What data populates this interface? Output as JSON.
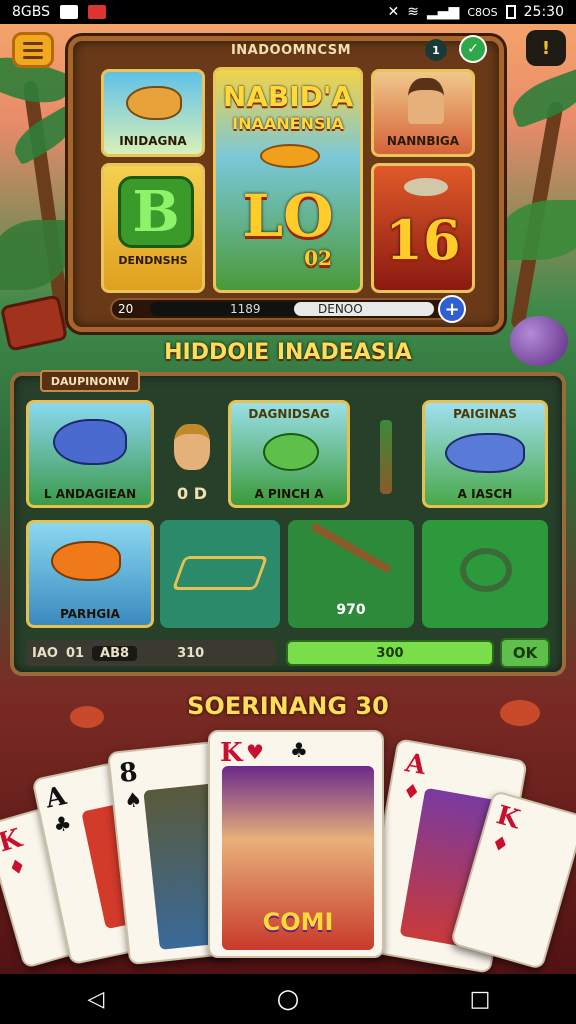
{
  "status_bar": {
    "left_text": "8GBS",
    "right_text": "C8OS",
    "time": "25:30"
  },
  "top_frame": {
    "title": "INADOOMNCSM",
    "tiles": [
      {
        "label": "INIDAGNA"
      },
      {
        "title_line1": "NABID'A",
        "title_line2": "INAANENSIA",
        "big_number": "LO",
        "small_number": "02"
      },
      {
        "label": "NANNBIGA"
      },
      {
        "label": "DENDNSHS"
      },
      {
        "big_number": "16"
      }
    ],
    "bar": {
      "left_value": "20",
      "mid_value": "1189",
      "right_value": "DENOO"
    },
    "plus_label": "+",
    "menu_badge": "!"
  },
  "mid_heading": "HIDDOIE INADEASIA",
  "mid_panel": {
    "tag": "DAUPINONW",
    "tiles": [
      {
        "label": "L ANDAGIEAN"
      },
      {
        "label": "0 D"
      },
      {
        "title": "DAGNIDSAG",
        "label": "A PINCH A"
      },
      {
        "title": "PAIGINAS",
        "label": "A IASCH"
      },
      {
        "label": "PARHGIA"
      },
      {
        "label": "970"
      }
    ],
    "bar": {
      "left_a": "IAO",
      "left_b": "01",
      "left_c": "AB8",
      "left_value": "310",
      "right_value": "300"
    },
    "ok_label": "OK"
  },
  "cards_heading": "SOERINANG 30",
  "cards": [
    {
      "rank": "K",
      "suit": "♦"
    },
    {
      "rank": "A",
      "suit": "♣"
    },
    {
      "rank": "8",
      "suit": "♠"
    },
    {
      "rank": "K",
      "suit": "♥",
      "suit2": "♣",
      "banner": "COMI"
    },
    {
      "rank": "A",
      "suit": "♦"
    },
    {
      "rank": "K",
      "suit": "♦"
    }
  ],
  "nav": {
    "back": "◁",
    "home": "○",
    "recents": "□"
  }
}
